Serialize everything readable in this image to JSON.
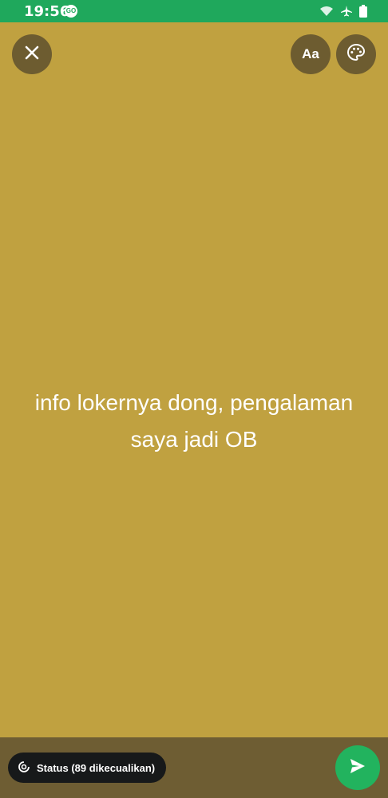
{
  "status_bar": {
    "time": "19:56",
    "app_badge": "GO",
    "icons": [
      "wifi-icon",
      "airplane-icon",
      "battery-icon"
    ]
  },
  "toolbar": {
    "close_icon": "close-icon",
    "font_label": "Aa",
    "palette_icon": "palette-icon"
  },
  "status_text": {
    "line1": "info lokernya dong, pengalaman",
    "line2": "saya jadi OB"
  },
  "bottom_bar": {
    "privacy_label": "Status (89 dikecualikan)",
    "send_icon": "send-icon"
  },
  "colors": {
    "background": "#c0a140",
    "status_bar": "#1fa85c",
    "button": "#6d5c30",
    "send_button": "#22b35e",
    "pill": "#17191a"
  }
}
